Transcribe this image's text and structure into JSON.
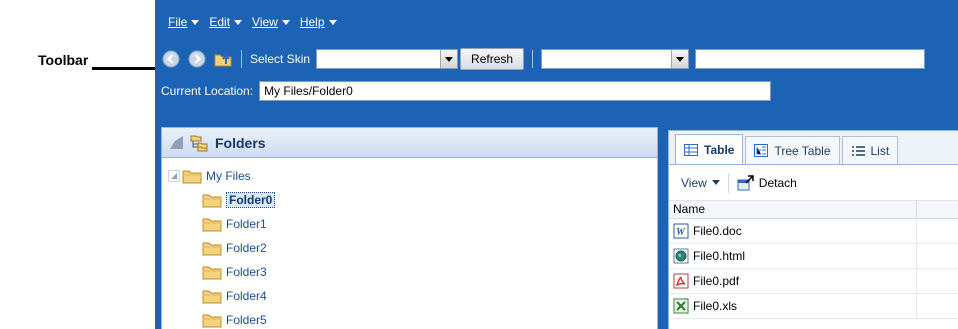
{
  "annotation": {
    "callout": "Toolbar"
  },
  "menubar": [
    {
      "label": "File"
    },
    {
      "label": "Edit"
    },
    {
      "label": "View"
    },
    {
      "label": "Help"
    }
  ],
  "toolbar": {
    "select_skin_label": "Select Skin",
    "skin_value": "",
    "refresh_label": "Refresh",
    "second_select_value": ""
  },
  "location": {
    "label": "Current Location:",
    "value": "My Files/Folder0"
  },
  "folders_panel": {
    "title": "Folders",
    "root": "My Files",
    "folders": [
      "Folder0",
      "Folder1",
      "Folder2",
      "Folder3",
      "Folder4",
      "Folder5"
    ],
    "selected": "Folder0"
  },
  "content_panel": {
    "tabs": [
      {
        "label": "Table",
        "active": true
      },
      {
        "label": "Tree Table",
        "active": false
      },
      {
        "label": "List",
        "active": false
      }
    ],
    "view_label": "View",
    "detach_label": "Detach",
    "column_name": "Name",
    "files": [
      {
        "name": "File0.doc",
        "type": "word-icon"
      },
      {
        "name": "File0.html",
        "type": "html-icon"
      },
      {
        "name": "File0.pdf",
        "type": "pdf-icon"
      },
      {
        "name": "File0.xls",
        "type": "excel-icon"
      }
    ]
  },
  "colors": {
    "app_blue": "#1c63b5",
    "folder_yellow": "#f2d27a",
    "link_blue": "#1a4f96"
  }
}
